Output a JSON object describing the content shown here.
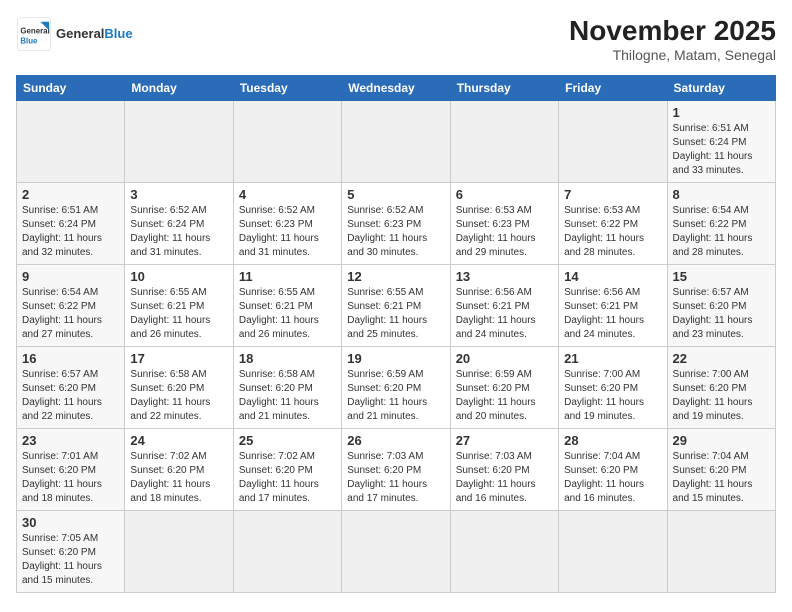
{
  "header": {
    "logo_general": "General",
    "logo_blue": "Blue",
    "title": "November 2025",
    "subtitle": "Thilogne, Matam, Senegal"
  },
  "days_of_week": [
    "Sunday",
    "Monday",
    "Tuesday",
    "Wednesday",
    "Thursday",
    "Friday",
    "Saturday"
  ],
  "weeks": [
    [
      {
        "day": "",
        "empty": true
      },
      {
        "day": "",
        "empty": true
      },
      {
        "day": "",
        "empty": true
      },
      {
        "day": "",
        "empty": true
      },
      {
        "day": "",
        "empty": true
      },
      {
        "day": "",
        "empty": true
      },
      {
        "day": "1",
        "sunrise": "6:51 AM",
        "sunset": "6:24 PM",
        "daylight": "11 hours and 33 minutes.",
        "weekend": true
      }
    ],
    [
      {
        "day": "2",
        "sunrise": "6:51 AM",
        "sunset": "6:24 PM",
        "daylight": "11 hours and 32 minutes.",
        "weekend": true
      },
      {
        "day": "3",
        "sunrise": "6:52 AM",
        "sunset": "6:24 PM",
        "daylight": "11 hours and 31 minutes."
      },
      {
        "day": "4",
        "sunrise": "6:52 AM",
        "sunset": "6:23 PM",
        "daylight": "11 hours and 31 minutes."
      },
      {
        "day": "5",
        "sunrise": "6:52 AM",
        "sunset": "6:23 PM",
        "daylight": "11 hours and 30 minutes."
      },
      {
        "day": "6",
        "sunrise": "6:53 AM",
        "sunset": "6:23 PM",
        "daylight": "11 hours and 29 minutes."
      },
      {
        "day": "7",
        "sunrise": "6:53 AM",
        "sunset": "6:22 PM",
        "daylight": "11 hours and 28 minutes."
      },
      {
        "day": "8",
        "sunrise": "6:54 AM",
        "sunset": "6:22 PM",
        "daylight": "11 hours and 28 minutes.",
        "weekend": true
      }
    ],
    [
      {
        "day": "9",
        "sunrise": "6:54 AM",
        "sunset": "6:22 PM",
        "daylight": "11 hours and 27 minutes.",
        "weekend": true
      },
      {
        "day": "10",
        "sunrise": "6:55 AM",
        "sunset": "6:21 PM",
        "daylight": "11 hours and 26 minutes."
      },
      {
        "day": "11",
        "sunrise": "6:55 AM",
        "sunset": "6:21 PM",
        "daylight": "11 hours and 26 minutes."
      },
      {
        "day": "12",
        "sunrise": "6:55 AM",
        "sunset": "6:21 PM",
        "daylight": "11 hours and 25 minutes."
      },
      {
        "day": "13",
        "sunrise": "6:56 AM",
        "sunset": "6:21 PM",
        "daylight": "11 hours and 24 minutes."
      },
      {
        "day": "14",
        "sunrise": "6:56 AM",
        "sunset": "6:21 PM",
        "daylight": "11 hours and 24 minutes."
      },
      {
        "day": "15",
        "sunrise": "6:57 AM",
        "sunset": "6:20 PM",
        "daylight": "11 hours and 23 minutes.",
        "weekend": true
      }
    ],
    [
      {
        "day": "16",
        "sunrise": "6:57 AM",
        "sunset": "6:20 PM",
        "daylight": "11 hours and 22 minutes.",
        "weekend": true
      },
      {
        "day": "17",
        "sunrise": "6:58 AM",
        "sunset": "6:20 PM",
        "daylight": "11 hours and 22 minutes."
      },
      {
        "day": "18",
        "sunrise": "6:58 AM",
        "sunset": "6:20 PM",
        "daylight": "11 hours and 21 minutes."
      },
      {
        "day": "19",
        "sunrise": "6:59 AM",
        "sunset": "6:20 PM",
        "daylight": "11 hours and 21 minutes."
      },
      {
        "day": "20",
        "sunrise": "6:59 AM",
        "sunset": "6:20 PM",
        "daylight": "11 hours and 20 minutes."
      },
      {
        "day": "21",
        "sunrise": "7:00 AM",
        "sunset": "6:20 PM",
        "daylight": "11 hours and 19 minutes."
      },
      {
        "day": "22",
        "sunrise": "7:00 AM",
        "sunset": "6:20 PM",
        "daylight": "11 hours and 19 minutes.",
        "weekend": true
      }
    ],
    [
      {
        "day": "23",
        "sunrise": "7:01 AM",
        "sunset": "6:20 PM",
        "daylight": "11 hours and 18 minutes.",
        "weekend": true
      },
      {
        "day": "24",
        "sunrise": "7:02 AM",
        "sunset": "6:20 PM",
        "daylight": "11 hours and 18 minutes."
      },
      {
        "day": "25",
        "sunrise": "7:02 AM",
        "sunset": "6:20 PM",
        "daylight": "11 hours and 17 minutes."
      },
      {
        "day": "26",
        "sunrise": "7:03 AM",
        "sunset": "6:20 PM",
        "daylight": "11 hours and 17 minutes."
      },
      {
        "day": "27",
        "sunrise": "7:03 AM",
        "sunset": "6:20 PM",
        "daylight": "11 hours and 16 minutes."
      },
      {
        "day": "28",
        "sunrise": "7:04 AM",
        "sunset": "6:20 PM",
        "daylight": "11 hours and 16 minutes."
      },
      {
        "day": "29",
        "sunrise": "7:04 AM",
        "sunset": "6:20 PM",
        "daylight": "11 hours and 15 minutes.",
        "weekend": true
      }
    ],
    [
      {
        "day": "30",
        "sunrise": "7:05 AM",
        "sunset": "6:20 PM",
        "daylight": "11 hours and 15 minutes.",
        "weekend": true
      },
      {
        "day": "",
        "empty": true
      },
      {
        "day": "",
        "empty": true
      },
      {
        "day": "",
        "empty": true
      },
      {
        "day": "",
        "empty": true
      },
      {
        "day": "",
        "empty": true
      },
      {
        "day": "",
        "empty": true
      }
    ]
  ]
}
